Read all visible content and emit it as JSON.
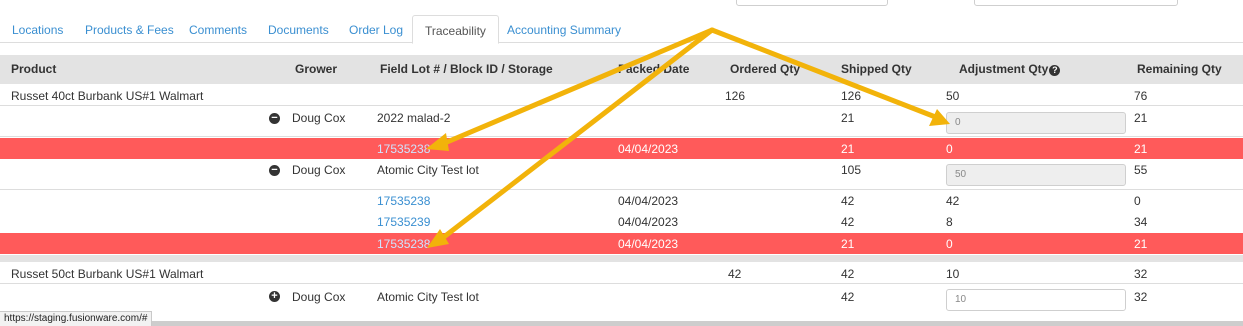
{
  "tabs": [
    {
      "label": "Locations"
    },
    {
      "label": "Products & Fees"
    },
    {
      "label": "Comments"
    },
    {
      "label": "Documents"
    },
    {
      "label": "Order Log"
    },
    {
      "label": "Traceability"
    },
    {
      "label": "Accounting Summary"
    }
  ],
  "table": {
    "headers": {
      "product": "Product",
      "grower": "Grower",
      "field_lot": "Field Lot # / Block ID / Storage",
      "packed_date": "Packed Date",
      "ordered_qty": "Ordered Qty",
      "shipped_qty": "Shipped Qty",
      "adjustment_qty": "Adjustment Qty",
      "remaining_qty": "Remaining Qty"
    },
    "rows": [
      {
        "product": "Russet 40ct Burbank US#1 Walmart",
        "ordered": "126",
        "shipped": "126",
        "adjustment": "50",
        "remaining": "76"
      },
      {
        "toggle": "minus",
        "grower": "Doug Cox",
        "lot": "2022 malad-2",
        "shipped": "21",
        "adjustment_input": "0",
        "remaining": "21"
      },
      {
        "lot": "17535238",
        "packed": "04/04/2023",
        "shipped": "21",
        "adjustment": "0",
        "remaining": "21",
        "highlight": "red"
      },
      {
        "toggle": "minus",
        "grower": "Doug Cox",
        "lot": "Atomic City Test lot",
        "shipped": "105",
        "adjustment_input": "50",
        "remaining": "55"
      },
      {
        "lot": "17535238",
        "packed": "04/04/2023",
        "shipped": "42",
        "adjustment": "42",
        "remaining": "0"
      },
      {
        "lot": "17535239",
        "packed": "04/04/2023",
        "shipped": "42",
        "adjustment": "8",
        "remaining": "34"
      },
      {
        "lot": "17535238",
        "packed": "04/04/2023",
        "shipped": "21",
        "adjustment": "0",
        "remaining": "21",
        "highlight": "red"
      },
      {
        "product": "Russet 50ct Burbank US#1 Walmart",
        "ordered": "42",
        "shipped": "42",
        "adjustment": "10",
        "remaining": "32"
      },
      {
        "toggle": "plus",
        "grower": "Doug Cox",
        "lot": "Atomic City Test lot",
        "shipped": "42",
        "adjustment_input": "10",
        "remaining": "32"
      }
    ]
  },
  "status_bar": {
    "url": "https://staging.fusionware.com/#"
  },
  "colors": {
    "link": "#3a8fd1",
    "highlight_row": "#ff5a5a",
    "header_bg": "#e3e3e3",
    "arrow": "#f2b30a"
  },
  "icons": {
    "help": "question-circle-icon",
    "collapse": "minus-circle-icon",
    "expand": "plus-circle-icon"
  }
}
